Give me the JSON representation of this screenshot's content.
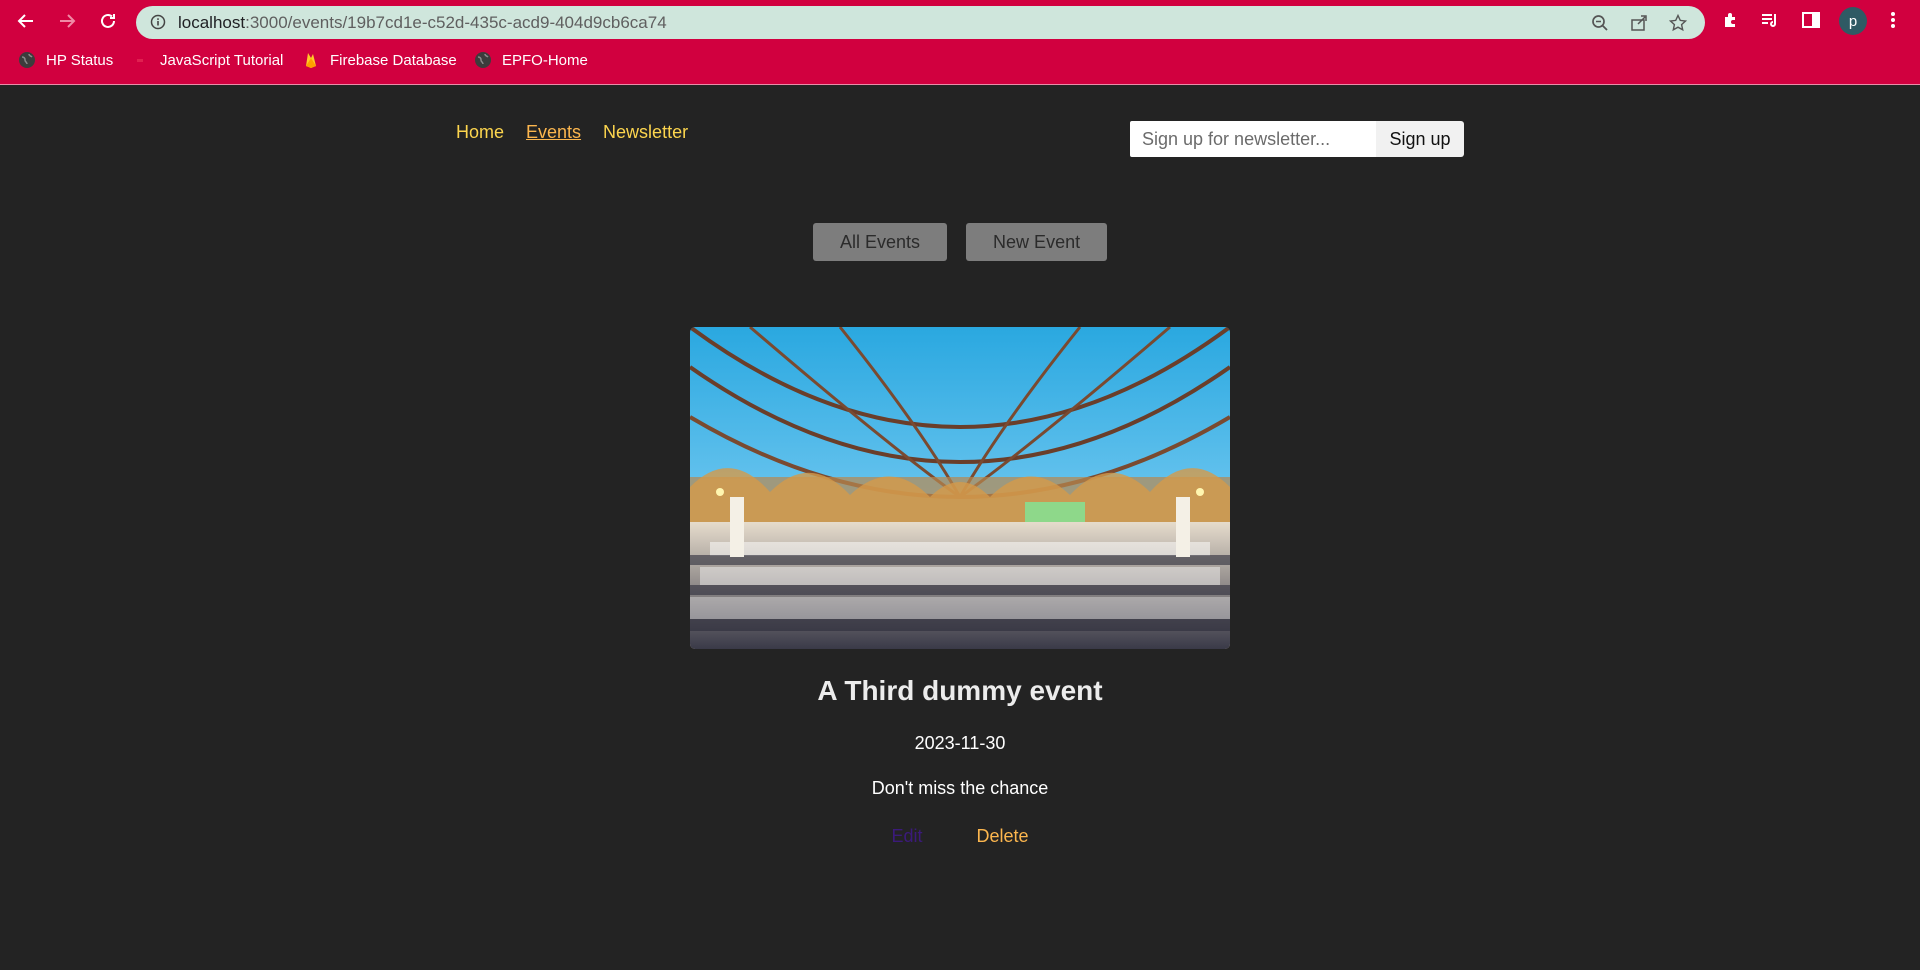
{
  "browser": {
    "url_host": "localhost",
    "url_path": ":3000/events/19b7cd1e-c52d-435c-acd9-404d9cb6ca74",
    "profile_initial": "p",
    "bookmarks": [
      {
        "label": "HP Status",
        "icon": "globe-icon"
      },
      {
        "label": "JavaScript Tutorial",
        "icon": "javascript-favicon-icon"
      },
      {
        "label": "Firebase Database",
        "icon": "firebase-flame-icon"
      },
      {
        "label": "EPFO-Home",
        "icon": "globe-icon"
      }
    ],
    "theme_color": "#d1003f"
  },
  "nav": {
    "items": [
      {
        "label": "Home",
        "active": false
      },
      {
        "label": "Events",
        "active": true
      },
      {
        "label": "Newsletter",
        "active": false
      }
    ],
    "link_color": "#fcd54e",
    "active_color": "#fcb64e"
  },
  "newsletter": {
    "placeholder": "Sign up for newsletter...",
    "button_label": "Sign up"
  },
  "events_nav": {
    "all_label": "All Events",
    "new_label": "New Event"
  },
  "event": {
    "title": "A Third dummy event",
    "date": "2023-11-30",
    "description": "Don't miss the chance",
    "edit_label": "Edit",
    "delete_label": "Delete"
  }
}
